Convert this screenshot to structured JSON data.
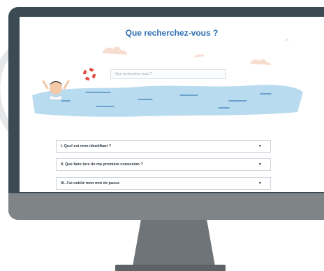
{
  "page": {
    "title": "Que recherchez-vous ?",
    "search_placeholder": "Que recherchez-vous ?"
  },
  "faq": [
    {
      "label": "I. Quel est mon identifiant ?"
    },
    {
      "label": "II. Que faire lors de ma première connexion ?"
    },
    {
      "label": "III. J'ai oublié mon mot de passe"
    }
  ],
  "colors": {
    "accent": "#2f6fb3",
    "water": "#b9dbef",
    "monitor_frame": "#3b4a53",
    "monitor_chin": "#7f8487"
  },
  "icons": {
    "faq_toggle": "chevron-down-icon",
    "lifebuoy": "lifebuoy-icon"
  }
}
